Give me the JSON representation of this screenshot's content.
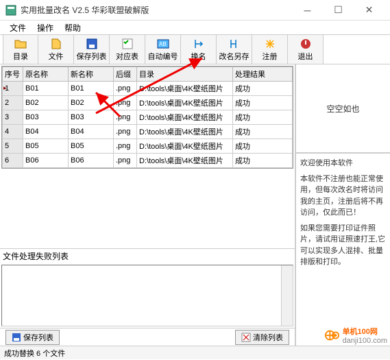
{
  "window": {
    "title": "实用批量改名 V2.5 华彩联盟破解版"
  },
  "menu": {
    "file": "文件",
    "op": "操作",
    "help": "帮助"
  },
  "toolbar": {
    "dir": "目录",
    "file": "文件",
    "savelist": "保存列表",
    "map": "对应表",
    "auto": "自动编号",
    "rename": "换名",
    "saveas": "改名另存",
    "reg": "注册",
    "exit": "退出"
  },
  "headers": {
    "no": "序号",
    "old": "原名称",
    "new": "新名称",
    "ext": "后缀",
    "dir": "目录",
    "result": "处理结果"
  },
  "rows": [
    {
      "no": "1",
      "old": "B01",
      "new": "B01",
      "ext": ".png",
      "dir": "D:\\tools\\桌面\\4K壁纸图片",
      "result": "成功"
    },
    {
      "no": "2",
      "old": "B02",
      "new": "B02",
      "ext": ".png",
      "dir": "D:\\tools\\桌面\\4K壁纸图片",
      "result": "成功"
    },
    {
      "no": "3",
      "old": "B03",
      "new": "B03",
      "ext": ".png",
      "dir": "D:\\tools\\桌面\\4K壁纸图片",
      "result": "成功"
    },
    {
      "no": "4",
      "old": "B04",
      "new": "B04",
      "ext": ".png",
      "dir": "D:\\tools\\桌面\\4K壁纸图片",
      "result": "成功"
    },
    {
      "no": "5",
      "old": "B05",
      "new": "B05",
      "ext": ".png",
      "dir": "D:\\tools\\桌面\\4K壁纸图片",
      "result": "成功"
    },
    {
      "no": "6",
      "old": "B06",
      "new": "B06",
      "ext": ".png",
      "dir": "D:\\tools\\桌面\\4K壁纸图片",
      "result": "成功"
    }
  ],
  "fail_label": "文件处理失败列表",
  "btns": {
    "save": "保存列表",
    "clear": "清除列表"
  },
  "right": {
    "empty": "空空如也",
    "welcome": "欢迎使用本软件",
    "p1": "本软件不注册也能正常使用，但每次改名时将访问我的主页，注册后将不再访问，仅此而已！",
    "p2": "如果您需要打印证件照片，请试用证照速打王,它可以实现多人混排、批量排版和打印。"
  },
  "status": "成功替换 6 个文件",
  "wm": {
    "brand": "单机100网",
    "url": "danji100.com"
  }
}
